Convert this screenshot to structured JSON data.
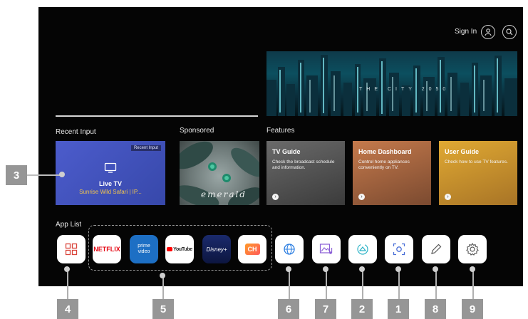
{
  "header": {
    "sign_in": "Sign In",
    "profile_icon": "person-icon",
    "search_icon": "search-icon"
  },
  "hero": {
    "text": "THE CITY 2050"
  },
  "sections": {
    "recent_input": "Recent Input",
    "sponsored": "Sponsored",
    "features": "Features",
    "app_list": "App List"
  },
  "recent_input_card": {
    "tag": "Recent Input",
    "title": "Live TV",
    "subtitle": "Sunrise Wild Safari | IP..."
  },
  "sponsored_card": {
    "text": "emerald"
  },
  "features": [
    {
      "title": "TV Guide",
      "desc": "Check the broadcast schedule and information.",
      "color": "#5d5d5d"
    },
    {
      "title": "Home Dashboard",
      "desc": "Control home appliances conveniently on TV.",
      "color": "#b06a43"
    },
    {
      "title": "User Guide",
      "desc": "Check how to use TV features.",
      "color": "#d49b2e"
    }
  ],
  "apps": [
    {
      "label": "",
      "icon": "grid-icon"
    },
    {
      "label": "NETFLIX"
    },
    {
      "label": "prime video"
    },
    {
      "label": "YouTube"
    },
    {
      "label": "Disney+"
    },
    {
      "label": "CH"
    },
    {
      "label": "",
      "icon": "globe-icon"
    },
    {
      "label": "",
      "icon": "gallery-music-icon"
    },
    {
      "label": "",
      "icon": "cast-icon"
    },
    {
      "label": "",
      "icon": "screen-capture-icon"
    },
    {
      "label": "",
      "icon": "pencil-icon"
    },
    {
      "label": "",
      "icon": "gear-icon"
    }
  ],
  "markers": [
    "3",
    "4",
    "5",
    "6",
    "7",
    "2",
    "1",
    "8",
    "9"
  ]
}
